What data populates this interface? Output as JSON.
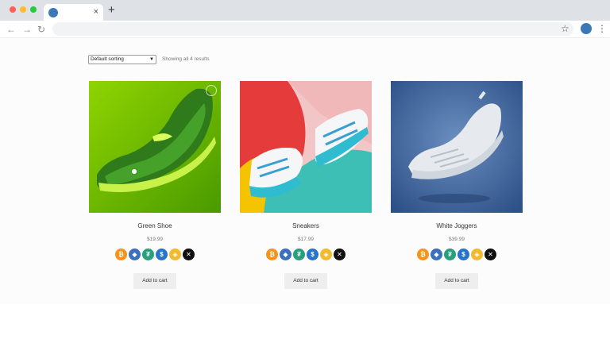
{
  "browser": {
    "tab_close": "×",
    "new_tab": "+",
    "nav": {
      "back": "←",
      "forward": "→",
      "reload": "↻"
    },
    "star": "☆",
    "menu": "⋮"
  },
  "shop": {
    "sort_value": "Default sorting",
    "results_text": "Showing all 4 results",
    "add_to_cart_label": "Add to cart",
    "coins": [
      "bitcoin-icon",
      "ethereum-icon",
      "tether-icon",
      "usdc-icon",
      "binance-icon",
      "xrp-icon"
    ],
    "coin_colors": [
      "#f7931a",
      "#3b6fc0",
      "#26a17b",
      "#2775ca",
      "#f3ba2f",
      "#111111"
    ],
    "coin_glyphs": [
      "₿",
      "◆",
      "₮",
      "$",
      "◈",
      "✕"
    ],
    "products": [
      {
        "title": "Green Shoe",
        "price": "$19.99"
      },
      {
        "title": "Sneakers",
        "price": "$17.99"
      },
      {
        "title": "White Joggers",
        "price": "$39.99"
      }
    ]
  }
}
